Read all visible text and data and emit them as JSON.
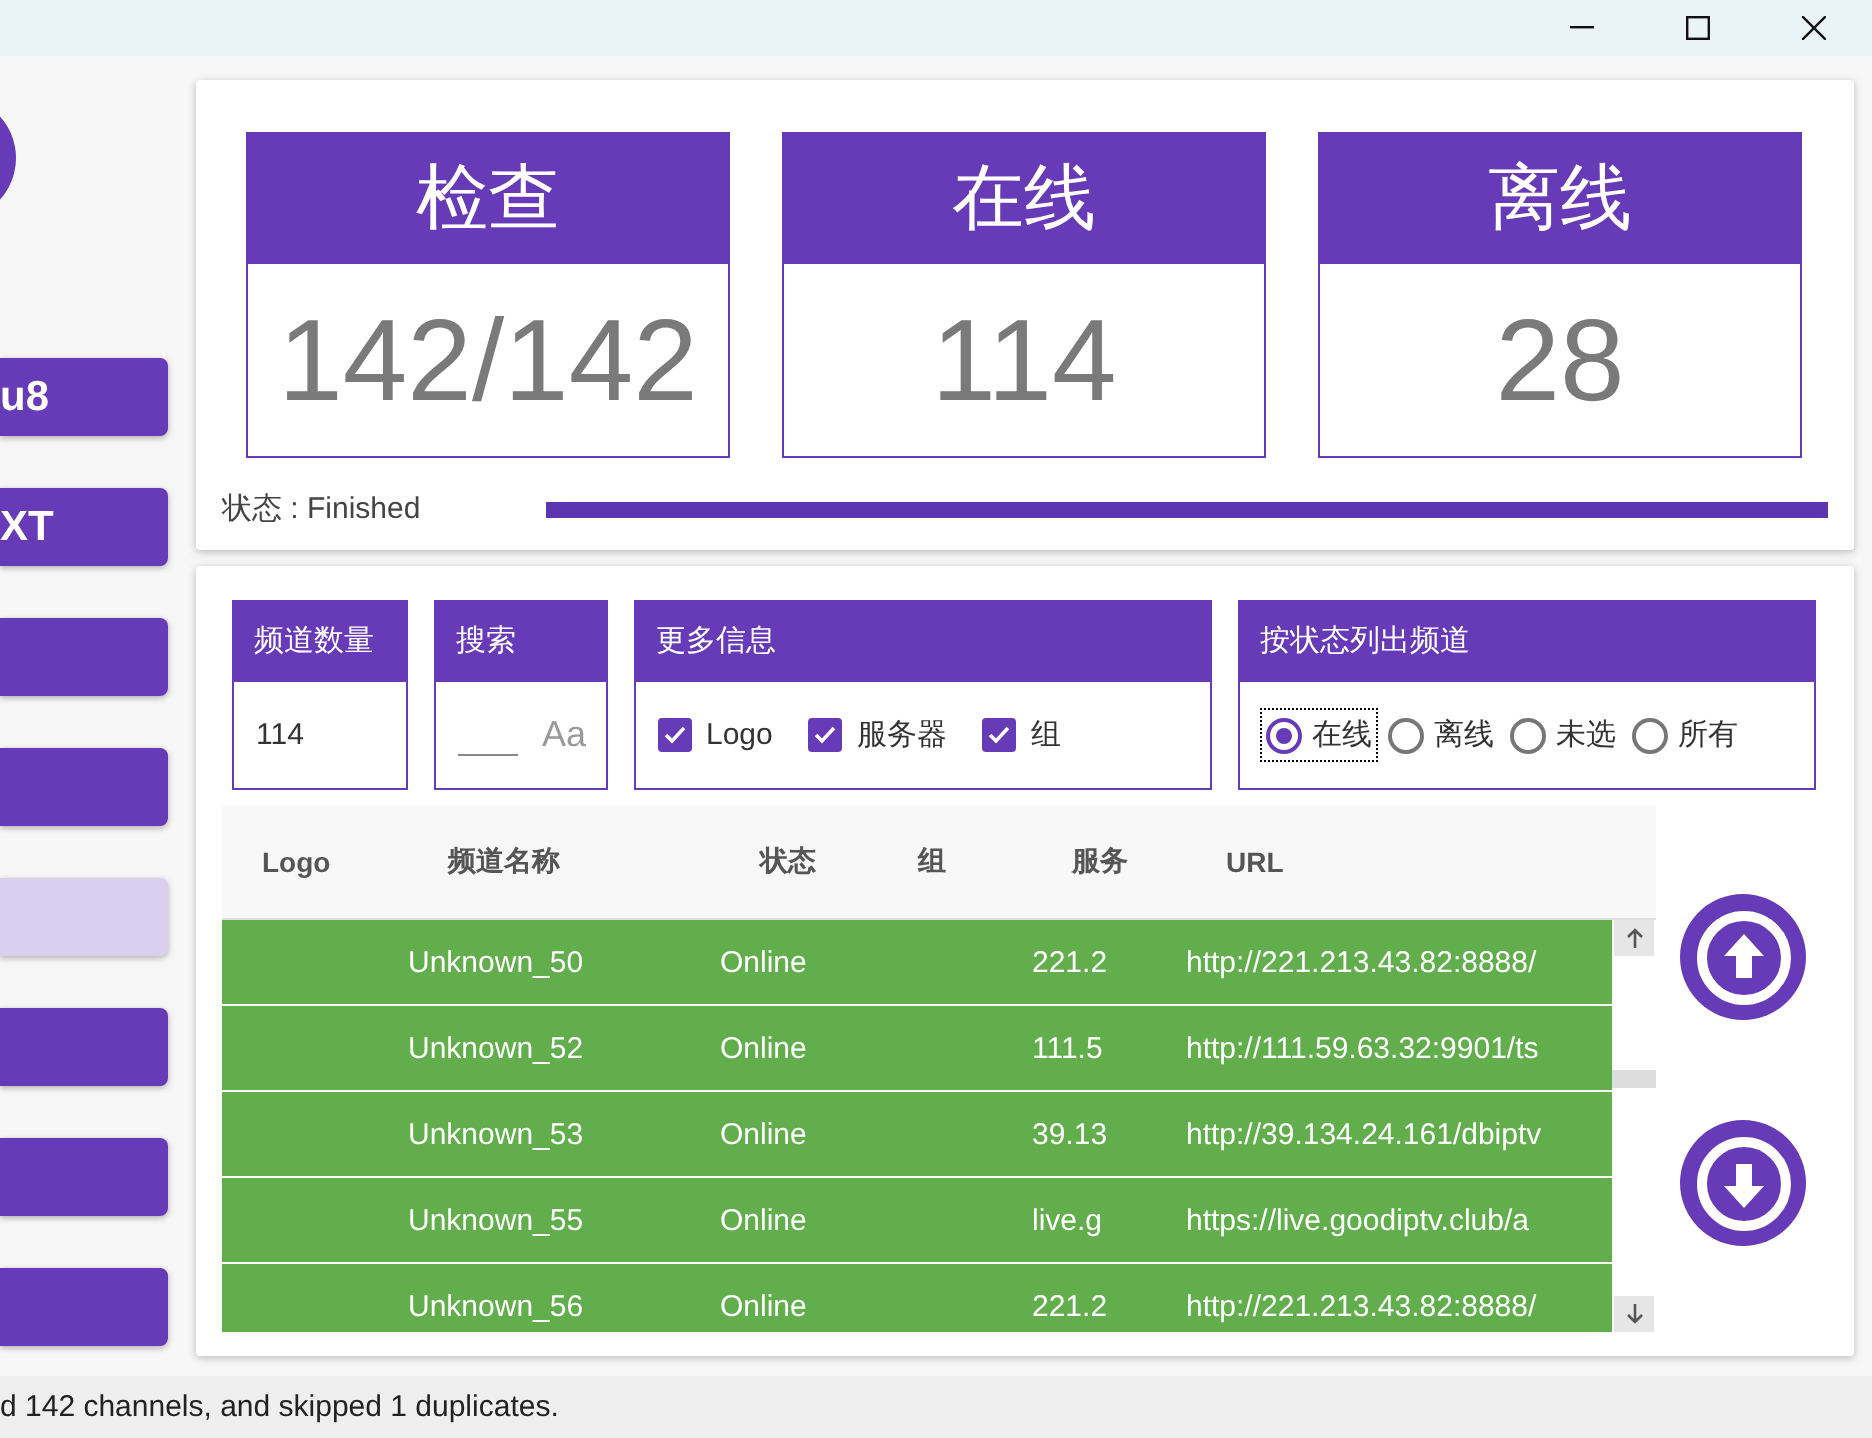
{
  "sidebar": {
    "buttons": [
      {
        "label": "u8",
        "disabled": false
      },
      {
        "label": "XT",
        "disabled": false
      },
      {
        "disabled": false
      },
      {
        "disabled": false
      },
      {
        "disabled": true
      },
      {
        "disabled": false
      },
      {
        "disabled": false
      },
      {
        "disabled": false
      }
    ]
  },
  "stats": [
    {
      "title": "检查",
      "value": "142/142"
    },
    {
      "title": "在线",
      "value": "114"
    },
    {
      "title": "离线",
      "value": "28"
    }
  ],
  "status": {
    "label": "状态 : Finished",
    "level": 1
  },
  "filters": {
    "count": {
      "title": "频道数量",
      "value": "114"
    },
    "search": {
      "title": "搜索",
      "case_toggle": "Aa"
    },
    "more_info": {
      "title": "更多信息",
      "options": [
        {
          "label": "Logo",
          "checked": true
        },
        {
          "label": "服务器",
          "checked": true
        },
        {
          "label": "组",
          "checked": true
        }
      ]
    },
    "by_status": {
      "title": "按状态列出频道",
      "options": [
        {
          "label": "在线",
          "selected": true
        },
        {
          "label": "离线",
          "selected": false
        },
        {
          "label": "未选",
          "selected": false
        },
        {
          "label": "所有",
          "selected": false
        }
      ]
    }
  },
  "table": {
    "columns": [
      "Logo",
      "频道名称",
      "状态",
      "组",
      "服务",
      "URL"
    ],
    "rows": [
      [
        "",
        "Unknown_50",
        "Online",
        "",
        "221.2",
        "http://221.213.43.82:8888/"
      ],
      [
        "",
        "Unknown_52",
        "Online",
        "",
        "111.5",
        "http://111.59.63.32:9901/ts"
      ],
      [
        "",
        "Unknown_53",
        "Online",
        "",
        "39.13",
        "http://39.134.24.161/dbiptv"
      ],
      [
        "",
        "Unknown_55",
        "Online",
        "",
        "live.g",
        "https://live.goodiptv.club/a"
      ],
      [
        "",
        "Unknown_56",
        "Online",
        "",
        "221.2",
        "http://221.213.43.82:8888/"
      ]
    ]
  },
  "status_bar": "d 142 channels, and skipped 1 duplicates."
}
